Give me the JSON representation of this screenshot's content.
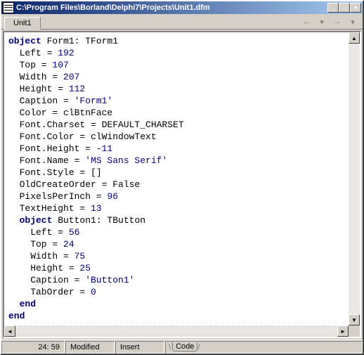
{
  "titlebar": {
    "path": "C:\\Program Files\\Borland\\Delphi7\\Projects\\Unit1.dfm"
  },
  "tabs": {
    "unit": "Unit1"
  },
  "nav": {
    "back": "←",
    "forward": "→"
  },
  "status": {
    "position": "24: 59",
    "modified": "Modified",
    "insert": "Insert",
    "view_tab": "Code"
  },
  "code": {
    "l1_kw": "object",
    "l1_rest": " Form1: TForm1",
    "l2_prop": "  Left = ",
    "l2_val": "192",
    "l3_prop": "  Top = ",
    "l3_val": "107",
    "l4_prop": "  Width = ",
    "l4_val": "207",
    "l5_prop": "  Height = ",
    "l5_val": "112",
    "l6_prop": "  Caption = ",
    "l6_val": "'Form1'",
    "l7": "  Color = clBtnFace",
    "l8": "  Font.Charset = DEFAULT_CHARSET",
    "l9": "  Font.Color = clWindowText",
    "l10_prop": "  Font.Height = ",
    "l10_val": "-11",
    "l11_prop": "  Font.Name = ",
    "l11_val": "'MS Sans Serif'",
    "l12": "  Font.Style = []",
    "l13": "  OldCreateOrder = False",
    "l14_prop": "  PixelsPerInch = ",
    "l14_val": "96",
    "l15_prop": "  TextHeight = ",
    "l15_val": "13",
    "l16_kw": "  object",
    "l16_rest": " Button1: TButton",
    "l17_prop": "    Left = ",
    "l17_val": "56",
    "l18_prop": "    Top = ",
    "l18_val": "24",
    "l19_prop": "    Width = ",
    "l19_val": "75",
    "l20_prop": "    Height = ",
    "l20_val": "25",
    "l21_prop": "    Caption = ",
    "l21_val": "'Button1'",
    "l22_prop": "    TabOrder = ",
    "l22_val": "0",
    "l23_kw": "  end",
    "l24_kw": "end"
  }
}
